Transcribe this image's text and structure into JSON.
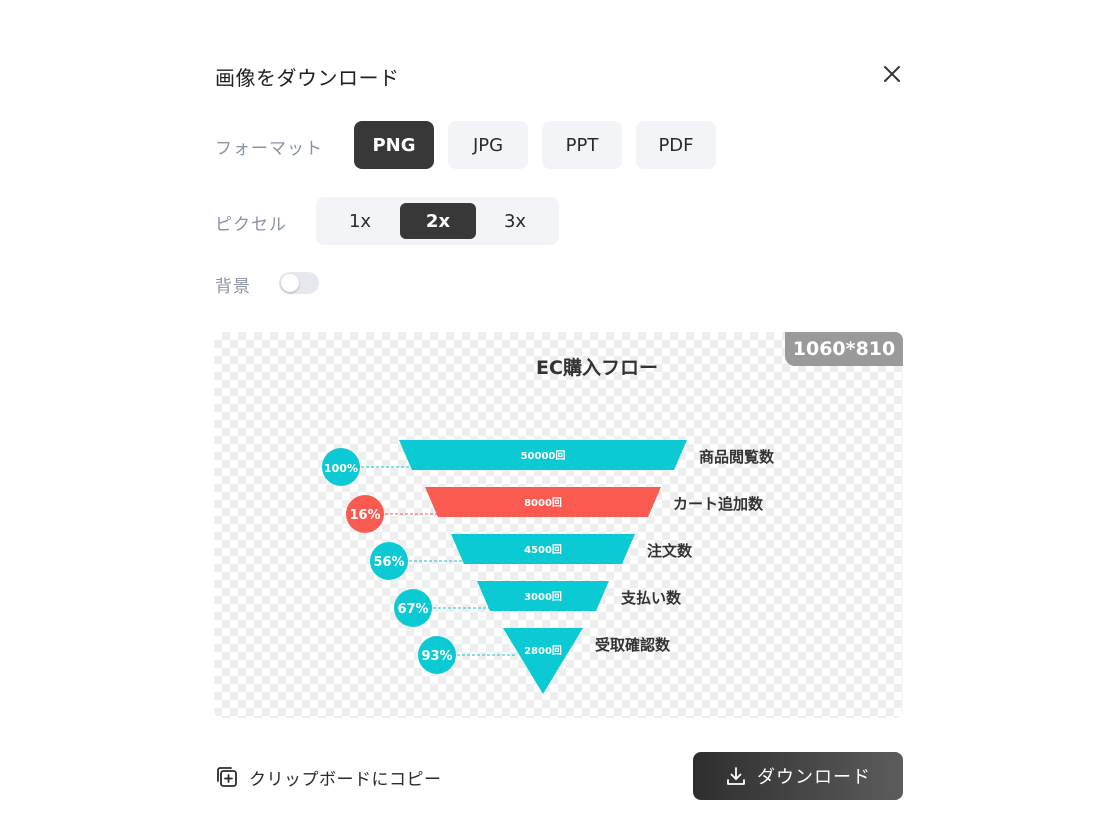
{
  "dialog": {
    "title": "画像をダウンロード"
  },
  "format": {
    "label": "フォーマット",
    "options": [
      "PNG",
      "JPG",
      "PPT",
      "PDF"
    ],
    "selected": "PNG"
  },
  "pixel": {
    "label": "ピクセル",
    "options": [
      "1x",
      "2x",
      "3x"
    ],
    "selected": "2x"
  },
  "background": {
    "label": "背景",
    "enabled": false
  },
  "preview": {
    "size_badge": "1060*810"
  },
  "actions": {
    "copy_label": "クリップボードにコピー",
    "download_label": "ダウンロード"
  },
  "colors": {
    "teal": "#0ccad3",
    "red": "#fa5a50",
    "dark": "#383838"
  },
  "chart_data": {
    "type": "funnel",
    "title": "EC購入フロー",
    "stages": [
      {
        "name": "商品閲覧数",
        "value_label": "50000回",
        "value": 50000,
        "rate": "100%",
        "color": "#0ccad3"
      },
      {
        "name": "カート追加数",
        "value_label": "8000回",
        "value": 8000,
        "rate": "16%",
        "color": "#fa5a50"
      },
      {
        "name": "注文数",
        "value_label": "4500回",
        "value": 4500,
        "rate": "56%",
        "color": "#0ccad3"
      },
      {
        "name": "支払い数",
        "value_label": "3000回",
        "value": 3000,
        "rate": "67%",
        "color": "#0ccad3"
      },
      {
        "name": "受取確認数",
        "value_label": "2800回",
        "value": 2800,
        "rate": "93%",
        "color": "#0ccad3"
      }
    ]
  }
}
